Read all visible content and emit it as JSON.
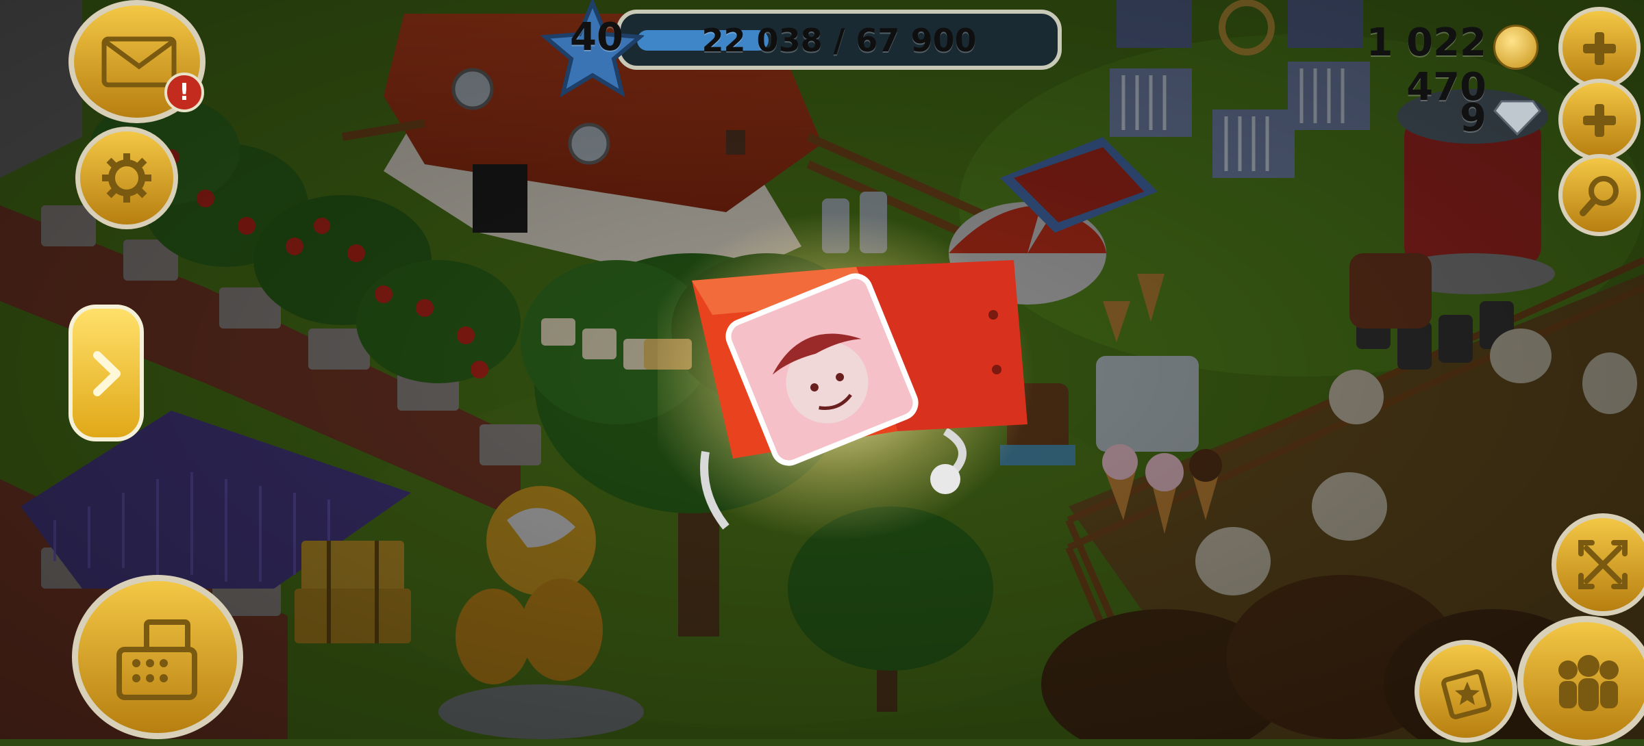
{
  "hud": {
    "level": "40",
    "xp_text": "22 038 / 67 900",
    "xp_progress": 0.3246,
    "coins": "1 022 470",
    "diamonds": "9"
  },
  "left_buttons": {
    "mail_badge": "!"
  },
  "popup": {
    "icon": "farmhand-portrait-icon"
  },
  "colors": {
    "accent_gold": "#e2a91a",
    "xp_blue": "#3f86c8",
    "chest_red": "#d8321e",
    "badge_red": "#c22b1d"
  }
}
